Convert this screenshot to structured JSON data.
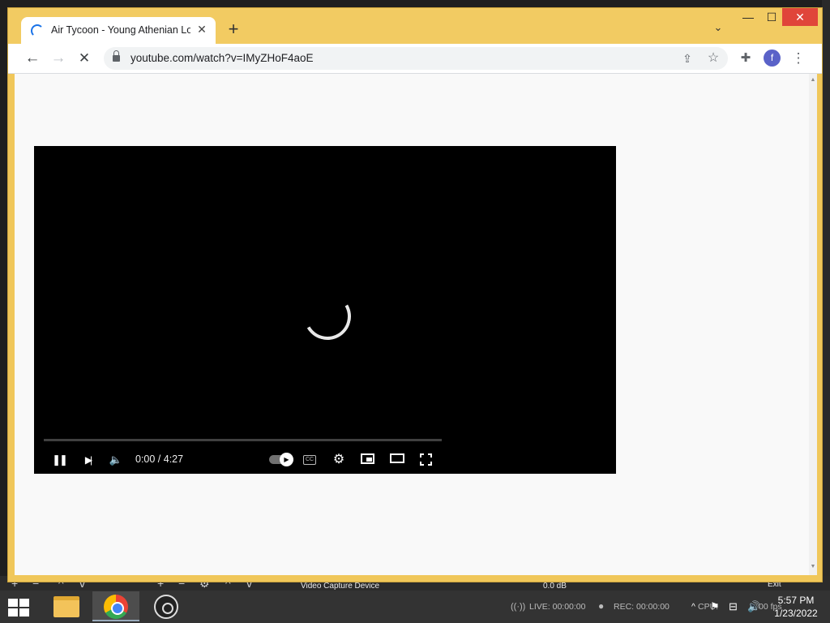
{
  "browser": {
    "tab": {
      "title": "Air Tycoon - Young Athenian Lov",
      "close": "✕"
    },
    "new_tab": "+",
    "tab_search": "⌄",
    "window": {
      "minimize": "—",
      "maximize": "☐",
      "close": "✕"
    },
    "toolbar": {
      "back": "←",
      "forward": "→",
      "stop": "✕",
      "url": "youtube.com/watch?v=IMyZHoF4aoE",
      "share": "⇪",
      "bookmark": "☆",
      "extensions": "✚",
      "profile_initial": "f",
      "menu": "⋮"
    }
  },
  "player": {
    "time_display": "0:00 / 4:27",
    "progress": 0,
    "pause": "❚❚",
    "next": "▶|",
    "volume": "🔈",
    "cc": "CC",
    "settings": "⚙",
    "autoplay_icon": "▶"
  },
  "obs": {
    "source_label": "Video Capture Device",
    "level": "0.0 dB",
    "exit": "Exit",
    "live": "LIVE: 00:00:00",
    "rec": "REC: 00:00:00",
    "cpu_partial": "CPU:",
    "fps_partial": "00 fps"
  },
  "taskbar": {
    "time": "5:57 PM",
    "date": "1/23/2022"
  },
  "colors": {
    "window_frame": "#f0c75a",
    "progress": "#ff0000",
    "close_button": "#e0453a",
    "profile": "#5a62c8"
  }
}
